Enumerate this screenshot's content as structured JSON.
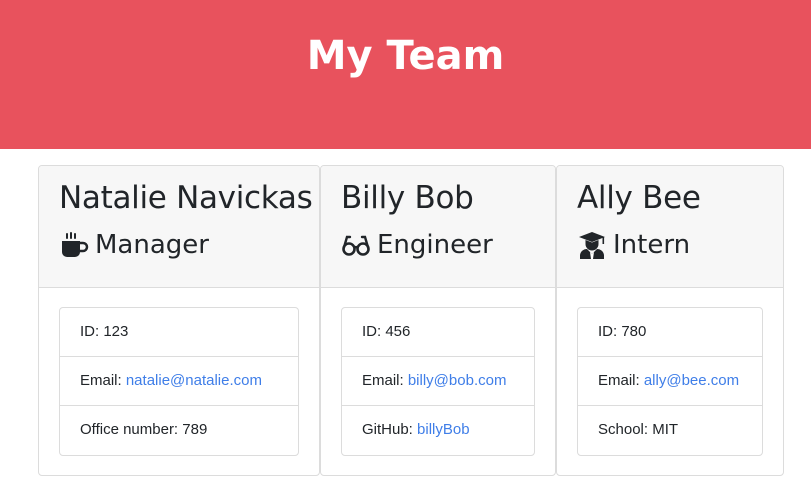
{
  "header": {
    "title": "My Team"
  },
  "cards": [
    {
      "name": "Natalie Navickas",
      "role": "Manager",
      "icon": "coffee-icon",
      "id_text": "ID: 123",
      "email_label": "Email: ",
      "email": "natalie@natalie.com",
      "extra_label": "Office number: 789",
      "extra_link": ""
    },
    {
      "name": "Billy Bob",
      "role": "Engineer",
      "icon": "glasses-icon",
      "id_text": "ID: 456",
      "email_label": "Email: ",
      "email": "billy@bob.com",
      "extra_label": "GitHub: ",
      "extra_link": "billyBob"
    },
    {
      "name": "Ally Bee",
      "role": "Intern",
      "icon": "graduate-icon",
      "id_text": "ID: 780",
      "email_label": "Email: ",
      "email": "ally@bee.com",
      "extra_label": "School: MIT",
      "extra_link": ""
    }
  ],
  "colors": {
    "header_bg": "#e8525d",
    "link": "#3f7ee8"
  }
}
